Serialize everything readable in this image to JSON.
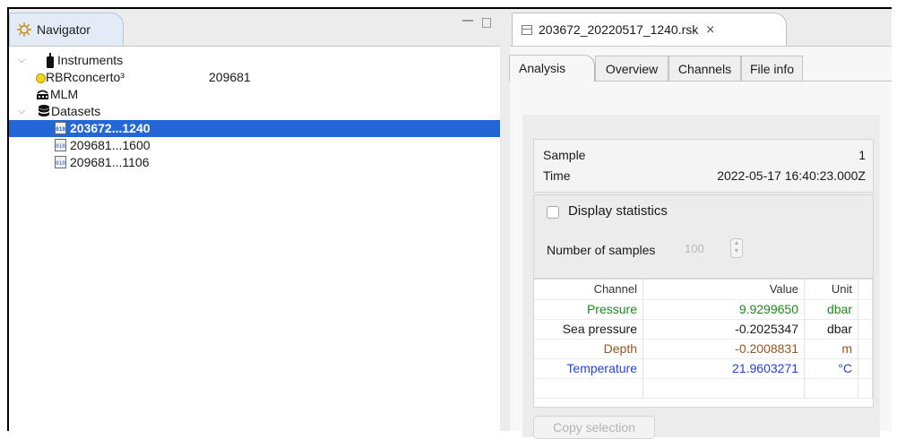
{
  "navigator": {
    "tab_label": "Navigator",
    "tree": [
      {
        "label": "Instruments",
        "value": "",
        "icon": "instrument-icon",
        "indent": 0,
        "expanded": true
      },
      {
        "label": "RBRconcerto³",
        "value": "209681",
        "icon": "status-dot-icon",
        "indent": 1
      },
      {
        "label": "MLM",
        "value": "",
        "icon": "mlm-icon",
        "indent": 1
      },
      {
        "label": "Datasets",
        "value": "",
        "icon": "database-icon",
        "indent": 0,
        "expanded": true
      },
      {
        "label": "203672...1240",
        "value": "",
        "icon": "binary-file-icon",
        "indent": 2,
        "selected": true
      },
      {
        "label": "209681...1600",
        "value": "",
        "icon": "binary-file-icon",
        "indent": 2
      },
      {
        "label": "209681...1106",
        "value": "",
        "icon": "binary-file-icon",
        "indent": 2
      }
    ]
  },
  "editor": {
    "file_tab_label": "203672_20220517_1240.rsk",
    "tabs": [
      "Analysis",
      "Overview",
      "Channels",
      "File info"
    ],
    "active_tab": "Analysis"
  },
  "analysis": {
    "sample_label": "Sample",
    "sample_value": "1",
    "time_label": "Time",
    "time_value": "2022-05-17 16:40:23.000Z",
    "display_statistics_label": "Display statistics",
    "display_statistics_checked": false,
    "number_of_samples_label": "Number of samples",
    "number_of_samples_value": "100",
    "table": {
      "headers": [
        "Channel",
        "Value",
        "Unit"
      ],
      "rows": [
        {
          "channel": "Pressure",
          "value": "9.9299650",
          "unit": "dbar",
          "color": "#1e8a1e"
        },
        {
          "channel": "Sea pressure",
          "value": "-0.2025347",
          "unit": "dbar",
          "color": "#1a1a1a"
        },
        {
          "channel": "Depth",
          "value": "-0.2008831",
          "unit": "m",
          "color": "#9a5520"
        },
        {
          "channel": "Temperature",
          "value": "21.9603271",
          "unit": "°C",
          "color": "#2543d8"
        }
      ]
    },
    "copy_selection_label": "Copy selection"
  },
  "colors": {
    "selection": "#2566d7",
    "pressure": "#1e8a1e",
    "depth": "#9a5520",
    "temperature": "#2543d8"
  }
}
